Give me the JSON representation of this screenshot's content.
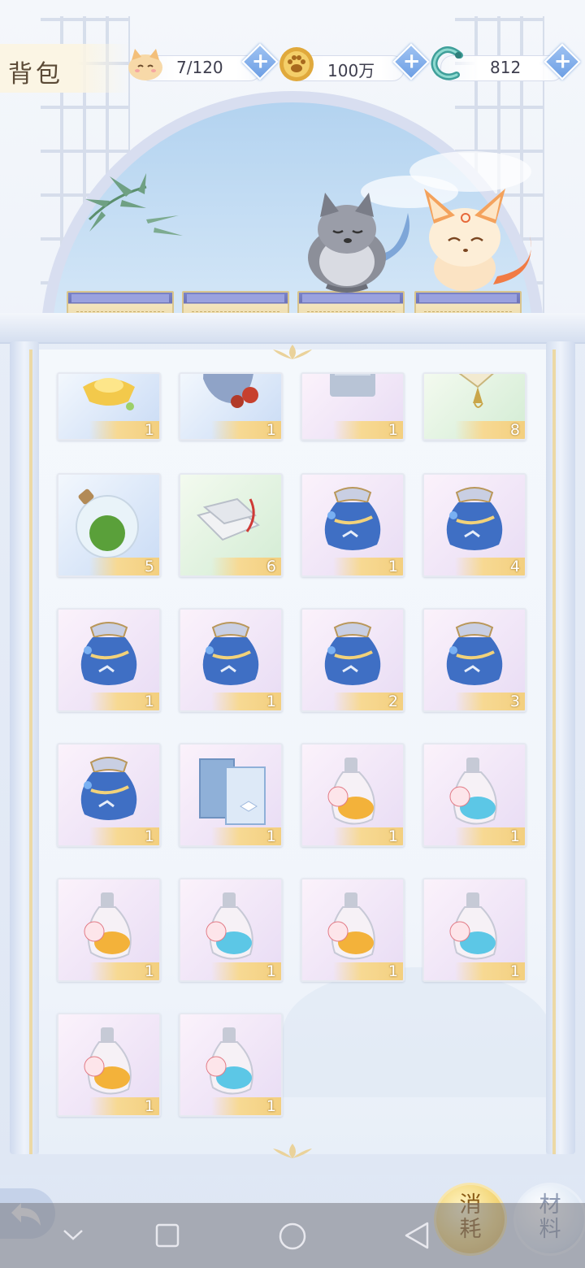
{
  "header": {
    "title": "背包",
    "resources": [
      {
        "icon": "cat-bun-icon",
        "value": "7/120"
      },
      {
        "icon": "gold-paw-coin-icon",
        "value": "100万"
      },
      {
        "icon": "jade-dragon-icon",
        "value": "812"
      }
    ],
    "add_icon": "plus-icon"
  },
  "scene": {
    "pets": [
      "gray-wolf-pet",
      "orange-fox-pet"
    ],
    "pedestal_count": 4
  },
  "inventory": {
    "items": [
      {
        "icon": "gold-ingot-icon",
        "qty": "1",
        "bg": "blue"
      },
      {
        "icon": "cloth-pouch-icon",
        "qty": "1",
        "bg": "blue"
      },
      {
        "icon": "red-orb-box-icon",
        "qty": "1",
        "bg": "purple"
      },
      {
        "icon": "folding-fan-icon",
        "qty": "8",
        "bg": "green"
      },
      {
        "icon": "green-potion-flask-icon",
        "qty": "5",
        "bg": "blue"
      },
      {
        "icon": "scroll-papers-icon",
        "qty": "6",
        "bg": "green"
      },
      {
        "icon": "blue-lucky-bag-icon",
        "qty": "1",
        "bg": "purple"
      },
      {
        "icon": "blue-lucky-bag-icon",
        "qty": "4",
        "bg": "purple"
      },
      {
        "icon": "blue-lucky-bag-icon",
        "qty": "1",
        "bg": "purple"
      },
      {
        "icon": "blue-lucky-bag-icon",
        "qty": "1",
        "bg": "purple"
      },
      {
        "icon": "blue-lucky-bag-icon",
        "qty": "2",
        "bg": "purple"
      },
      {
        "icon": "blue-lucky-bag-icon",
        "qty": "3",
        "bg": "purple"
      },
      {
        "icon": "blue-lucky-bag-icon",
        "qty": "1",
        "bg": "purple"
      },
      {
        "icon": "household-book-icon",
        "qty": "1",
        "bg": "purple"
      },
      {
        "icon": "double-orange-bottle-icon",
        "qty": "1",
        "bg": "purple"
      },
      {
        "icon": "double-blue-bottle-icon",
        "qty": "1",
        "bg": "purple"
      },
      {
        "icon": "double-orange-bottle-icon",
        "qty": "1",
        "bg": "purple"
      },
      {
        "icon": "double-blue-bottle-icon",
        "qty": "1",
        "bg": "purple"
      },
      {
        "icon": "double-orange-bottle-icon",
        "qty": "1",
        "bg": "purple"
      },
      {
        "icon": "double-blue-bottle-icon",
        "qty": "1",
        "bg": "purple"
      },
      {
        "icon": "double-orange-bottle-icon",
        "qty": "1",
        "bg": "purple"
      },
      {
        "icon": "double-blue-bottle-icon",
        "qty": "1",
        "bg": "purple"
      }
    ]
  },
  "tabs": {
    "consume": "消\n耗",
    "material": "材\n料"
  },
  "colors": {
    "gold_accent": "#f3cf7f",
    "panel_bg": "#f1f5fb",
    "plus_blue": "#6d9fe4"
  }
}
